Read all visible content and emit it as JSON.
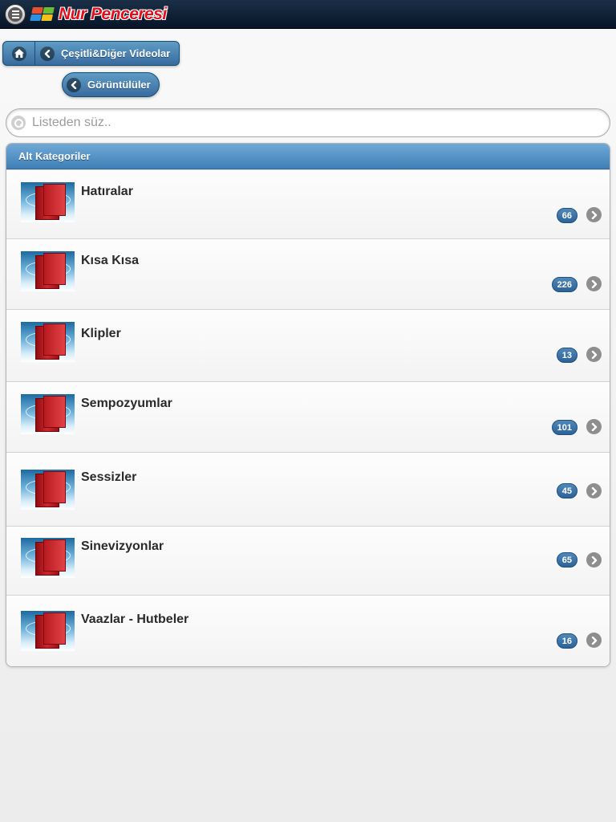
{
  "header": {
    "menu_icon": "menu-icon",
    "logo_text": "Nur Penceresi",
    "logo_colors": [
      "#e8512c",
      "#6cbd2f",
      "#2f8fe0",
      "#f5c21b"
    ]
  },
  "nav": {
    "home_icon": "home-icon",
    "back_label": "Çeşitli&Diğer Videolar",
    "sub_label": "Görüntülüler"
  },
  "search": {
    "placeholder": "Listeden süz..",
    "value": ""
  },
  "list": {
    "header": "Alt Kategoriler",
    "items": [
      {
        "title": "Hatıralar",
        "count": "66"
      },
      {
        "title": "Kısa Kısa",
        "count": "226"
      },
      {
        "title": "Klipler",
        "count": "13"
      },
      {
        "title": "Sempozyumlar",
        "count": "101"
      },
      {
        "title": "Sessizler",
        "count": "45"
      },
      {
        "title": "Sinevizyonlar",
        "count": "65"
      },
      {
        "title": "Vaazlar - Hutbeler",
        "count": "16"
      }
    ]
  },
  "colors": {
    "accent": "#3f7fb6",
    "header_bg": "#061528",
    "logo_red": "#e0101c"
  }
}
